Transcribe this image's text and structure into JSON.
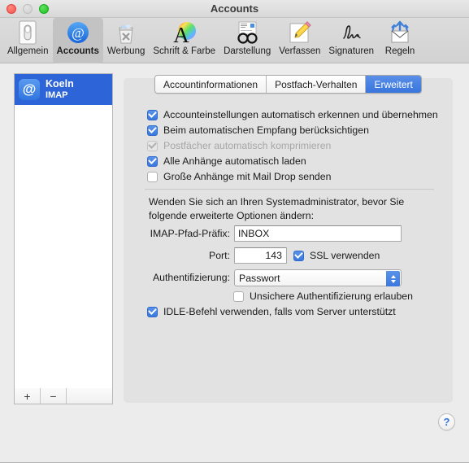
{
  "window": {
    "title": "Accounts",
    "traffic_lights": [
      "close-button",
      "minimize-button",
      "maximize-button"
    ]
  },
  "toolbar": {
    "items": [
      {
        "label": "Allgemein",
        "icon": "general-switch-icon",
        "selected": false
      },
      {
        "label": "Accounts",
        "icon": "at-sign-icon",
        "selected": true
      },
      {
        "label": "Werbung",
        "icon": "junk-trash-icon",
        "selected": false
      },
      {
        "label": "Schrift & Farbe",
        "icon": "font-color-icon",
        "selected": false
      },
      {
        "label": "Darstellung",
        "icon": "glasses-viewing-icon",
        "selected": false
      },
      {
        "label": "Verfassen",
        "icon": "pencil-compose-icon",
        "selected": false
      },
      {
        "label": "Signaturen",
        "icon": "signature-icon",
        "selected": false
      },
      {
        "label": "Regeln",
        "icon": "rules-envelope-icon",
        "selected": false
      }
    ]
  },
  "sidebar": {
    "accounts": [
      {
        "name": "Koeln",
        "type": "IMAP",
        "icon_glyph": "@",
        "selected": true
      }
    ],
    "add_label": "+",
    "remove_label": "−"
  },
  "tabs": [
    {
      "label": "Accountinformationen",
      "active": false
    },
    {
      "label": "Postfach-Verhalten",
      "active": false
    },
    {
      "label": "Erweitert",
      "active": true
    }
  ],
  "options": {
    "checkboxes": [
      {
        "label": "Accounteinstellungen automatisch erkennen und übernehmen",
        "checked": true,
        "disabled": false
      },
      {
        "label": "Beim automatischen Empfang berücksichtigen",
        "checked": true,
        "disabled": false
      },
      {
        "label": "Postfächer automatisch komprimieren",
        "checked": true,
        "disabled": true
      },
      {
        "label": "Alle Anhänge automatisch laden",
        "checked": true,
        "disabled": false
      },
      {
        "label": "Große Anhänge mit Mail Drop senden",
        "checked": false,
        "disabled": false
      }
    ]
  },
  "advanced": {
    "admin_note": "Wenden Sie sich an Ihren Systemadministrator, bevor Sie folgende erweiterte Optionen ändern:",
    "imap_prefix_label": "IMAP-Pfad-Präfix:",
    "imap_prefix_value": "INBOX",
    "port_label": "Port:",
    "port_value": "143",
    "ssl_label": "SSL verwenden",
    "ssl_checked": true,
    "auth_label": "Authentifizierung:",
    "auth_value": "Passwort",
    "auth_options": [
      "Passwort"
    ],
    "insecure_auth_label": "Unsichere Authentifizierung erlauben",
    "insecure_auth_checked": false,
    "idle_label": "IDLE-Befehl verwenden, falls vom Server unterstützt",
    "idle_checked": true
  },
  "help": {
    "label": "?"
  },
  "colors": {
    "accent_blue": "#3a78df",
    "selection_blue": "#2d64d8",
    "window_bg": "#ececec",
    "panel_bg": "#e2e2e2",
    "toolbar_bg": "#d6d6d6"
  }
}
